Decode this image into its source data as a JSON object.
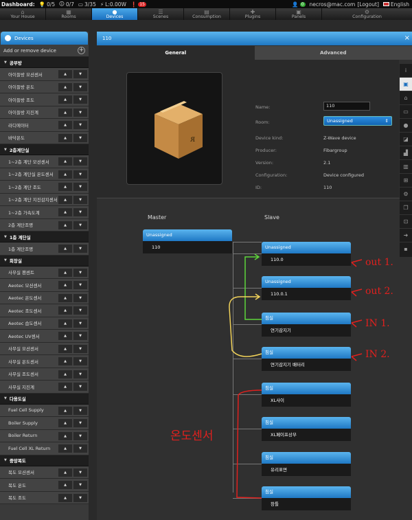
{
  "topbar": {
    "dashboard": "Dashboard:",
    "bulbs": "0/5",
    "lamps": "0/7",
    "devices_count": "3/35",
    "power": "L:0.00W",
    "alerts": "15",
    "user": "necros@mac.com",
    "logout": "[Logout]",
    "language": "English",
    "toggle_state": "0"
  },
  "nav": {
    "tabs": [
      "Your House",
      "Rooms",
      "Devices",
      "Scenes",
      "Consumption",
      "Plugins",
      "Panels",
      "Configuration"
    ],
    "active": "Devices"
  },
  "sidebar": {
    "header": "Devices",
    "add_label": "Add or remove device",
    "groups": [
      {
        "room": "공부방",
        "devices": [
          "아이들방 모션센서",
          "아이들방 온도",
          "아이들방 조도",
          "아이들방 지진계",
          "라디에이터",
          "바닥온도"
        ]
      },
      {
        "room": "2층계단실",
        "devices": [
          "1~2층 계단 모션센서",
          "1~2층 계단실 온도센서",
          "1~2층 계단 조도",
          "1~2층 계단 지진감지센서",
          "1~2층 가속도계",
          "2층 계단조명"
        ]
      },
      {
        "room": "1층 계단실",
        "devices": [
          "1층 계단조명"
        ]
      },
      {
        "room": "회장실",
        "devices": [
          "사무실 팬센트",
          "Aeotec 모션센서",
          "Aeotec 온도센서",
          "Aeotec 조도센서",
          "Aeotec 습도센서",
          "Aeotec UV센서",
          "사무실 모션센서",
          "사무실 온도센서",
          "사무실 조도센서",
          "사무실 지진계"
        ]
      },
      {
        "room": "다용도실",
        "devices": [
          "Fuel Cell Supply",
          "Boiler Supply",
          "Boiler Return",
          "Fuel Cell XL Return"
        ]
      },
      {
        "room": "중앙복도",
        "devices": [
          "복도 모션센서",
          "복도 온도",
          "복도 조도"
        ]
      }
    ]
  },
  "panel": {
    "title": "110",
    "tab_general": "General",
    "tab_advanced": "Advanced",
    "fields": [
      {
        "label": "Name:",
        "value": "110"
      },
      {
        "label": "Room:",
        "value": "Unassigned"
      },
      {
        "label": "Device kind:",
        "value": "Z-Wave device"
      },
      {
        "label": "Producer:",
        "value": "Fibargroup"
      },
      {
        "label": "Version:",
        "value": "2.1"
      },
      {
        "label": "Configuration:",
        "value": "Device configured"
      },
      {
        "label": "ID:",
        "value": "110"
      }
    ]
  },
  "assoc": {
    "master_label": "Master",
    "slave_label": "Slave",
    "master": {
      "room": "Unassigned",
      "name": "110"
    },
    "slaves": [
      {
        "room": "Unassigned",
        "name": "110.0"
      },
      {
        "room": "Unassigned",
        "name": "110.0.1"
      },
      {
        "room": "침실",
        "name": "연기감지기"
      },
      {
        "room": "침실",
        "name": "연기감지기 배터리"
      },
      {
        "room": "침실",
        "name": "XL사이"
      },
      {
        "room": "침실",
        "name": "XL페이프상부"
      },
      {
        "room": "침실",
        "name": "유리표면"
      },
      {
        "room": "침실",
        "name": "창틀"
      }
    ]
  },
  "annotations": {
    "out1": "out 1.",
    "out2": "out 2.",
    "in1": "IN 1.",
    "in2": "IN 2.",
    "korean": "온도센서"
  },
  "colors": {
    "accent": "#2a8ee0",
    "annotation_red": "#e0201e",
    "annotation_green": "#5ed63a",
    "annotation_yellow": "#f2d35a"
  }
}
